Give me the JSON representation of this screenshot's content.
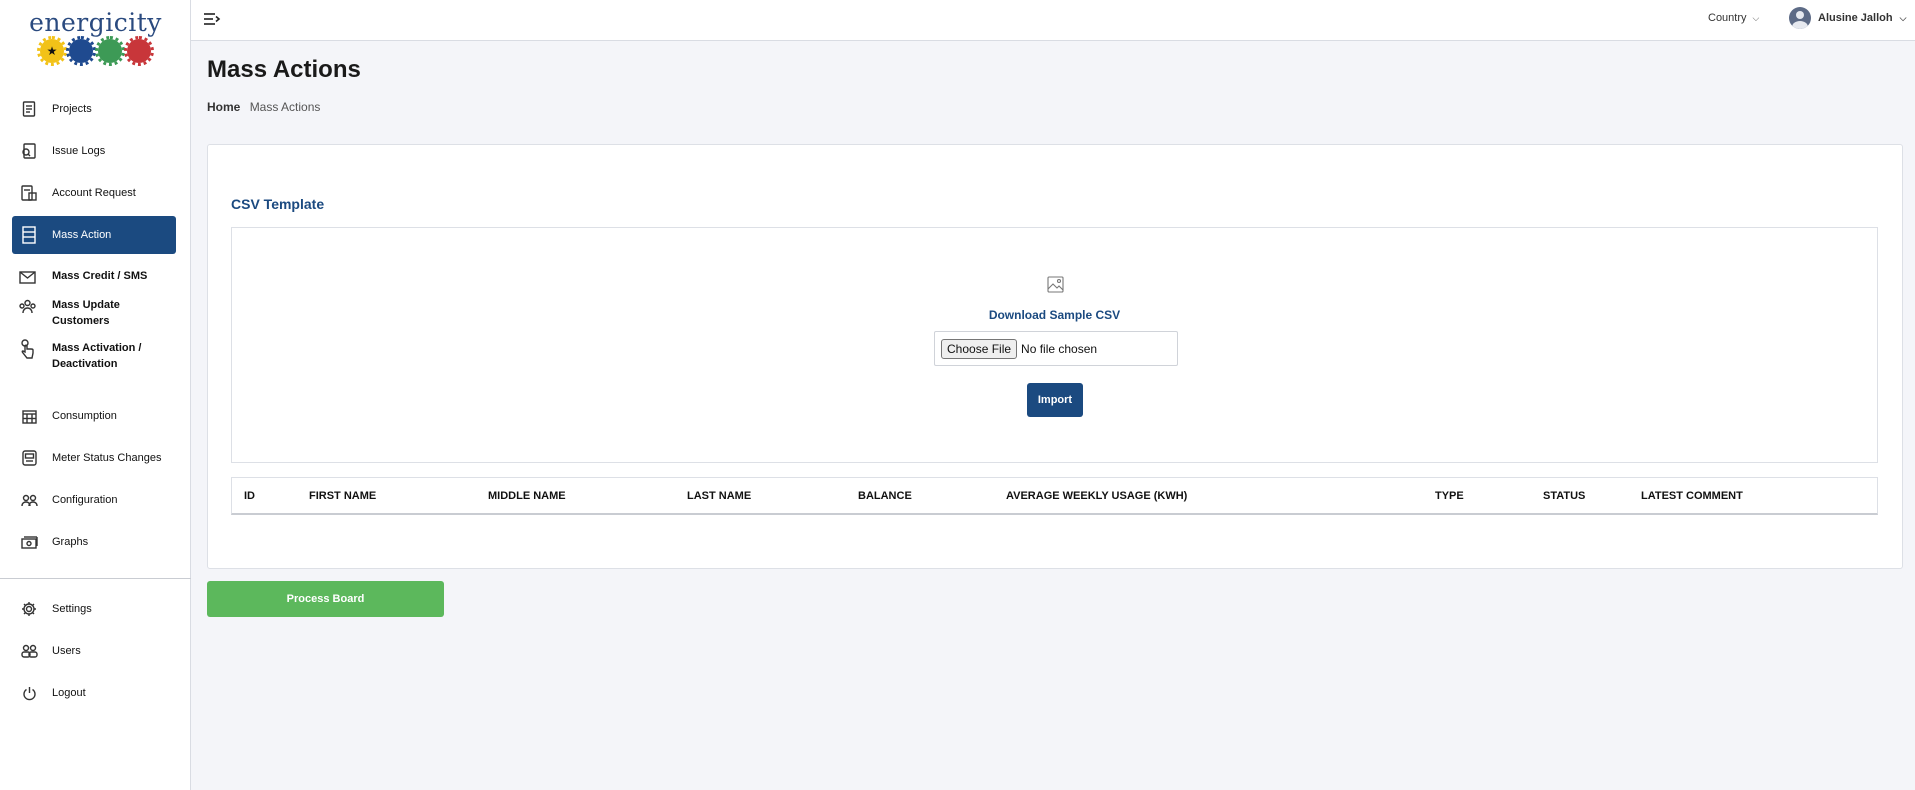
{
  "app": {
    "logo_text": "energicity",
    "logo_icon": "energicity-sun-logo"
  },
  "sidebar": {
    "items": [
      {
        "label": "Projects",
        "icon": "document-icon"
      },
      {
        "label": "Issue Logs",
        "icon": "issue-log-icon"
      },
      {
        "label": "Account Request",
        "icon": "account-request-icon"
      },
      {
        "label": "Mass Action",
        "icon": "table-icon",
        "active": true
      },
      {
        "label": "Consumption",
        "icon": "calendar-icon"
      },
      {
        "label": "Meter Status Changes",
        "icon": "meter-icon"
      },
      {
        "label": "Configuration",
        "icon": "users-config-icon"
      },
      {
        "label": "Graphs",
        "icon": "money-graph-icon"
      }
    ],
    "sub_items": [
      {
        "label": "Mass Credit / SMS",
        "icon": "envelope-icon"
      },
      {
        "label": "Mass Update Customers",
        "icon": "people-icon"
      },
      {
        "label": "Mass Activation / Deactivation",
        "icon": "hand-pointer-icon"
      }
    ],
    "bottom_items": [
      {
        "label": "Settings",
        "icon": "gear-icon"
      },
      {
        "label": "Users",
        "icon": "users-icon"
      },
      {
        "label": "Logout",
        "icon": "power-icon"
      }
    ]
  },
  "topbar": {
    "country_label": "Country",
    "user_name": "Alusine Jalloh"
  },
  "page": {
    "title": "Mass Actions",
    "breadcrumb": {
      "home": "Home",
      "current": "Mass Actions"
    }
  },
  "card": {
    "title": "CSV Template",
    "download_link": "Download Sample CSV",
    "file_button": "Choose File",
    "file_status": "No file chosen",
    "import_button": "Import",
    "table_columns": [
      "ID",
      "FIRST NAME",
      "MIDDLE NAME",
      "LAST NAME",
      "BALANCE",
      "AVERAGE WEEKLY USAGE (KWH)",
      "TYPE",
      "STATUS",
      "LATEST COMMENT"
    ]
  },
  "process_button": "Process Board",
  "colors": {
    "primary": "#1b4a80",
    "success": "#5cb85c",
    "background": "#f4f5f9"
  }
}
